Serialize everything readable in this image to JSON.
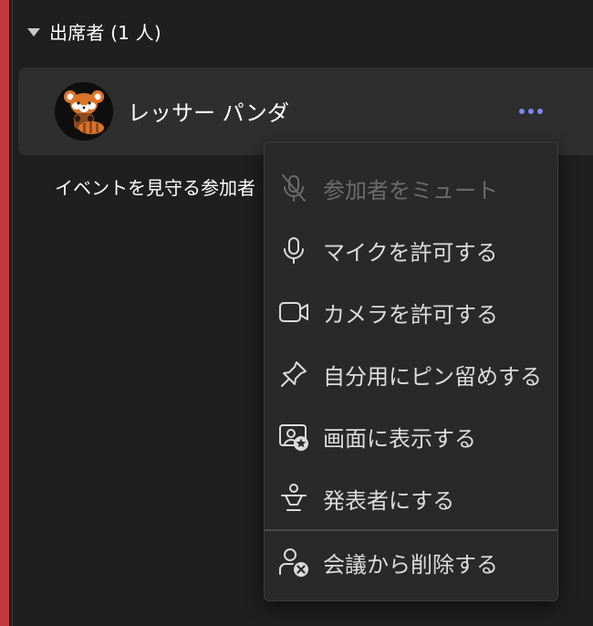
{
  "section": {
    "title": "出席者 (1 人)"
  },
  "participant": {
    "name": "レッサー パンダ",
    "avatar_icon": "red-panda-avatar",
    "more_icon": "more-options-icon"
  },
  "subsection": {
    "title": "イベントを見守る参加者"
  },
  "menu": {
    "items": [
      {
        "label": "参加者をミュート",
        "icon": "mic-off-icon",
        "enabled": false
      },
      {
        "label": "マイクを許可する",
        "icon": "mic-icon",
        "enabled": true
      },
      {
        "label": "カメラを許可する",
        "icon": "camera-icon",
        "enabled": true
      },
      {
        "label": "自分用にピン留めする",
        "icon": "pin-icon",
        "enabled": true
      },
      {
        "label": "画面に表示する",
        "icon": "spotlight-icon",
        "enabled": true
      },
      {
        "label": "発表者にする",
        "icon": "presenter-icon",
        "enabled": true
      },
      {
        "label": "会議から削除する",
        "icon": "remove-person-icon",
        "enabled": true
      }
    ]
  },
  "colors": {
    "accent_bar": "#c4383d",
    "more_dots": "#7f85f5",
    "background": "#1f1f1f",
    "menu_background": "#292929"
  }
}
